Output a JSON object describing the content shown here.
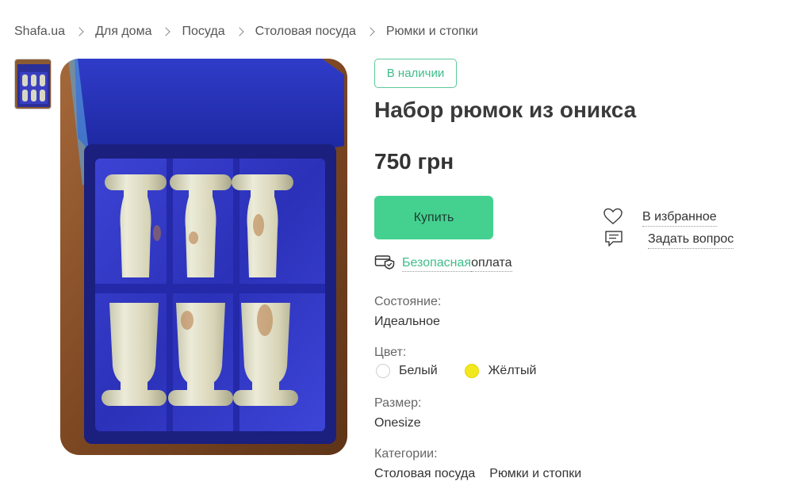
{
  "breadcrumb": [
    "Shafa.ua",
    "Для дома",
    "Посуда",
    "Столовая посуда",
    "Рюмки и стопки"
  ],
  "product": {
    "stock_badge": "В наличии",
    "title": "Набор рюмок из оникса",
    "price": "750 грн",
    "buy_label": "Купить",
    "favorite_label": "В избранное",
    "ask_label": "Задать вопрос",
    "secure_accent": "Безопасная",
    "secure_rest": " оплата"
  },
  "specs": {
    "condition_label": "Состояние:",
    "condition_value": "Идеальное",
    "color_label": "Цвет:",
    "color_options": [
      {
        "name": "Белый",
        "swatch": "#ffffff"
      },
      {
        "name": "Жёлтый",
        "swatch": "#f2e81e"
      }
    ],
    "size_label": "Размер:",
    "size_value": "Onesize",
    "categories_label": "Категории:",
    "categories": [
      "Столовая посуда",
      "Рюмки и стопки"
    ]
  },
  "colors": {
    "accent": "#44d190",
    "accent_text": "#3fbc8a"
  },
  "icons": [
    "heart-icon",
    "chat-icon",
    "secure-payment-icon",
    "chevron-right-icon"
  ]
}
